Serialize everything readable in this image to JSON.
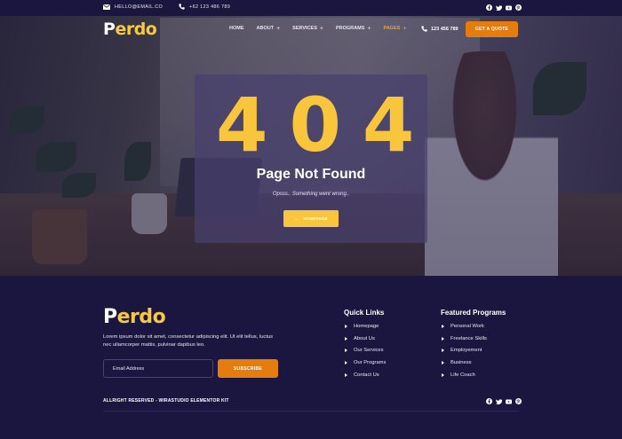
{
  "topbar": {
    "email": "HELLO@EMAIL.CO",
    "phone": "+62 123 486 789"
  },
  "brand": {
    "first": "P",
    "rest": "erdo",
    "first_color": "#ffffff",
    "rest_color": "#f7c842"
  },
  "nav": {
    "items": [
      {
        "label": "HOME",
        "has_submenu": false,
        "active": false
      },
      {
        "label": "ABOUT",
        "has_submenu": true,
        "active": false
      },
      {
        "label": "SERVICES",
        "has_submenu": true,
        "active": false
      },
      {
        "label": "PROGRAMS",
        "has_submenu": true,
        "active": false
      },
      {
        "label": "PAGES",
        "has_submenu": true,
        "active": true
      }
    ],
    "submenu_marker": "+",
    "phone": "123 456 789",
    "cta_label": "GET A QUOTE"
  },
  "error": {
    "code": "404",
    "title": "Page Not Found",
    "subtitle": "Opsss.. Something went wrong..",
    "button_label": "HOMEPAGE",
    "button_arrow": "←"
  },
  "footer": {
    "description": "Lorem ipsum dolor sit amet, consectetur adipiscing elit. Ut elit tellus, luctus nec ullamcorper mattis, pulvinar dapibus leo.",
    "email_placeholder": "Email Address",
    "subscribe_label": "SUBSCRIBE",
    "quick_links": {
      "title": "Quick Links",
      "items": [
        "Homepage",
        "About Us",
        "Our Services",
        "Our Programs",
        "Contact Us"
      ]
    },
    "featured_programs": {
      "title": "Featured Programs",
      "items": [
        "Personal Work",
        "Freelance Skills",
        "Employement",
        "Business",
        "Life Coach"
      ]
    },
    "copyright": "ALLRIGHT RESERVED - WIRASTUDIO ELEMENTOR KIT"
  },
  "social": [
    "facebook-icon",
    "twitter-icon",
    "youtube-icon",
    "pinterest-icon"
  ],
  "colors": {
    "navy": "#1b1640",
    "accent_orange": "#e57c0e",
    "accent_yellow": "#f9c53d"
  }
}
